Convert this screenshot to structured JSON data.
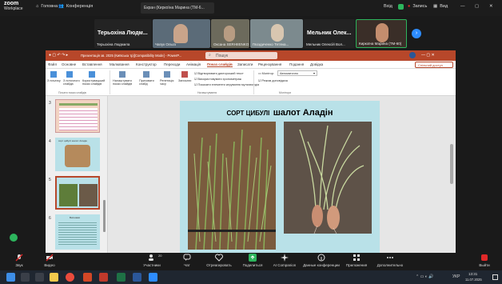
{
  "zoom": {
    "logo_line1": "zoom",
    "logo_line2": "Workplace",
    "home": "Головна",
    "conference": "Конференція",
    "screen_title": "Екран (Киркоїна Марина (ТМ-6...",
    "login": "Вхід",
    "recording": "Запись",
    "view": "Вид"
  },
  "participants": [
    {
      "big": "Терьохіна Людм...",
      "name": "Терьохіна Людмила"
    },
    {
      "big": "",
      "name": "Чапук Ольга"
    },
    {
      "big": "",
      "name": "Оксана SERHIIENKO"
    },
    {
      "big": "",
      "name": "Гвоздиченко Тетяна..."
    },
    {
      "big": "Мельник Олек...",
      "name": "Мельник Олексій Вол..."
    },
    {
      "big": "",
      "name": "Киркоїна Марина (ТМ-60)"
    }
  ],
  "ppt": {
    "title": "Презентація зв. 2025 (Київська тр)[Compatibility Mode] - PowerP...",
    "search": "Пошук",
    "share": "Спільний доступ",
    "menu": [
      "Файл",
      "Основне",
      "Вставлення",
      "Малювання",
      "Конструктор",
      "Переходи",
      "Анімація",
      "Показ слайдів",
      "Записати",
      "Рецензування",
      "Подання",
      "Довідка"
    ],
    "ribbon_groups": {
      "group1": "Почати показ слайдів",
      "group2": "Налаштування",
      "group3": "Монітори"
    },
    "ribbon_buttons": [
      "З початку",
      "З поточного слайда",
      "Користувацький показ слайдів",
      "Налаштувати показ слайдів",
      "Приховати слайд",
      "Репетиція часу",
      "Записати"
    ],
    "ribbon_checks": [
      "Відтворювати дикторський текст",
      "Використовувати хронометраж",
      "Показати елементи керування мультимедіа"
    ],
    "monitor_label": "Монітор:",
    "monitor_value": "Автоматично",
    "presenter_view": "Режим доповідача",
    "slide_title_small": "СОРТ ЦИБУЛІ",
    "slide_title_big": "шалот Аладін",
    "thumb_numbers": [
      "3",
      "4",
      "5",
      "6"
    ],
    "thumb4_title": "сорт цибулі шалот Аладін",
    "thumb6_title": "Висновки"
  },
  "toolbar": {
    "audio": "Звук",
    "video": "Видео",
    "participants": "Участники",
    "participants_count": "20",
    "chat": "Чат",
    "react": "Отреагировать",
    "share": "Поделиться",
    "companion": "AI Companion",
    "summary": "Данные конференции",
    "apps": "Приложения",
    "more": "Дополнительно",
    "leave": "Выйти"
  },
  "taskbar": {
    "time": "13:31",
    "date": "11.07.2025",
    "lang": "УКР"
  },
  "colors": {
    "ppt_accent": "#b7472a",
    "zoom_green": "#2db55d",
    "zoom_red": "#e02828"
  }
}
